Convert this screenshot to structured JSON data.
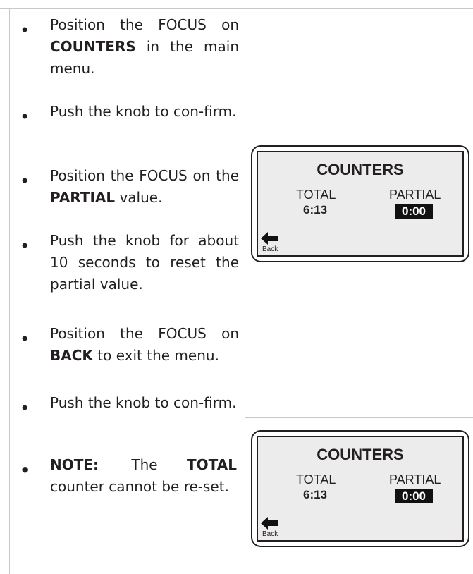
{
  "instructions": [
    {
      "parts": [
        {
          "t": "Position the FOCUS on "
        },
        {
          "t": "COUNTERS",
          "b": true
        },
        {
          "t": " in the main menu."
        }
      ]
    },
    {
      "parts": [
        {
          "t": "Push the knob to con-firm."
        }
      ]
    },
    {
      "parts": [
        {
          "t": "Position the FOCUS on the "
        },
        {
          "t": "PARTIAL",
          "b": true
        },
        {
          "t": " value."
        }
      ]
    },
    {
      "parts": [
        {
          "t": "Push the knob for about 10 seconds to reset the partial value."
        }
      ]
    },
    {
      "parts": [
        {
          "t": "Position the FOCUS on "
        },
        {
          "t": "BACK",
          "b": true
        },
        {
          "t": " to exit the menu."
        }
      ]
    },
    {
      "parts": [
        {
          "t": "Push the knob to con-firm."
        }
      ]
    }
  ],
  "note": {
    "label": "NOTE:",
    "the": "The",
    "total": "TOTAL",
    "rest": "counter cannot be re-set."
  },
  "bullet_char": "•",
  "panels": [
    {
      "title": "COUNTERS",
      "total_label": "TOTAL",
      "total_value": "6:13",
      "partial_label": "PARTIAL",
      "partial_value": "0:00",
      "back_label": "Back",
      "back_icon": "left-arrow-icon"
    },
    {
      "title": "COUNTERS",
      "total_label": "TOTAL",
      "total_value": "6:13",
      "partial_label": "PARTIAL",
      "partial_value": "0:00",
      "back_label": "Back",
      "back_icon": "left-arrow-icon"
    }
  ]
}
